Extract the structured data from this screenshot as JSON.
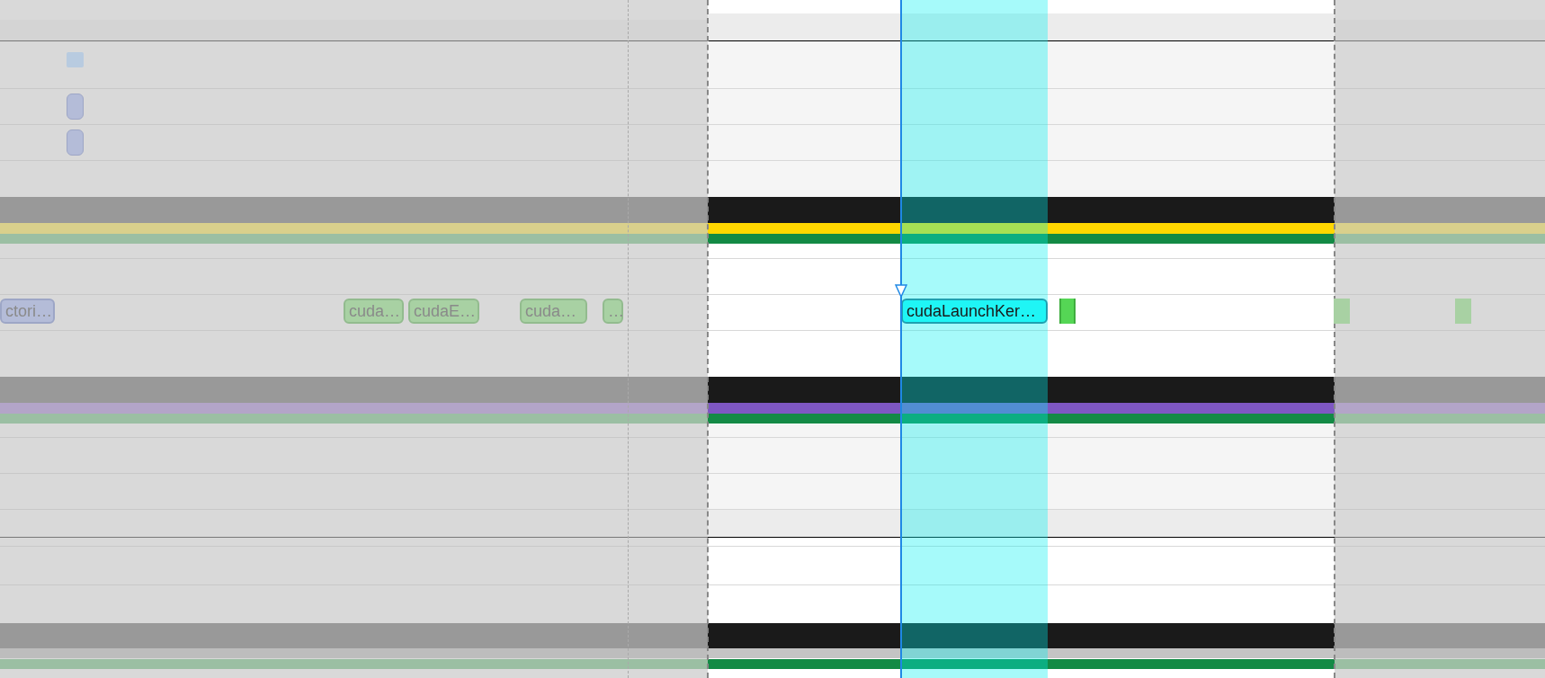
{
  "slices": [
    {
      "label": "ctori…",
      "kind": "runtime",
      "dimmed": true
    },
    {
      "label": "cuda…",
      "kind": "api",
      "dimmed": true
    },
    {
      "label": "cudaE…",
      "kind": "api",
      "dimmed": true
    },
    {
      "label": "cuda…",
      "kind": "api",
      "dimmed": true
    },
    {
      "label": "…",
      "kind": "api",
      "dimmed": true
    },
    {
      "label": "cudaLaunchKer…",
      "kind": "selected",
      "dimmed": false
    }
  ],
  "blocks": [
    {
      "dimmed": false
    },
    {
      "dimmed": true
    },
    {
      "dimmed": true
    }
  ]
}
